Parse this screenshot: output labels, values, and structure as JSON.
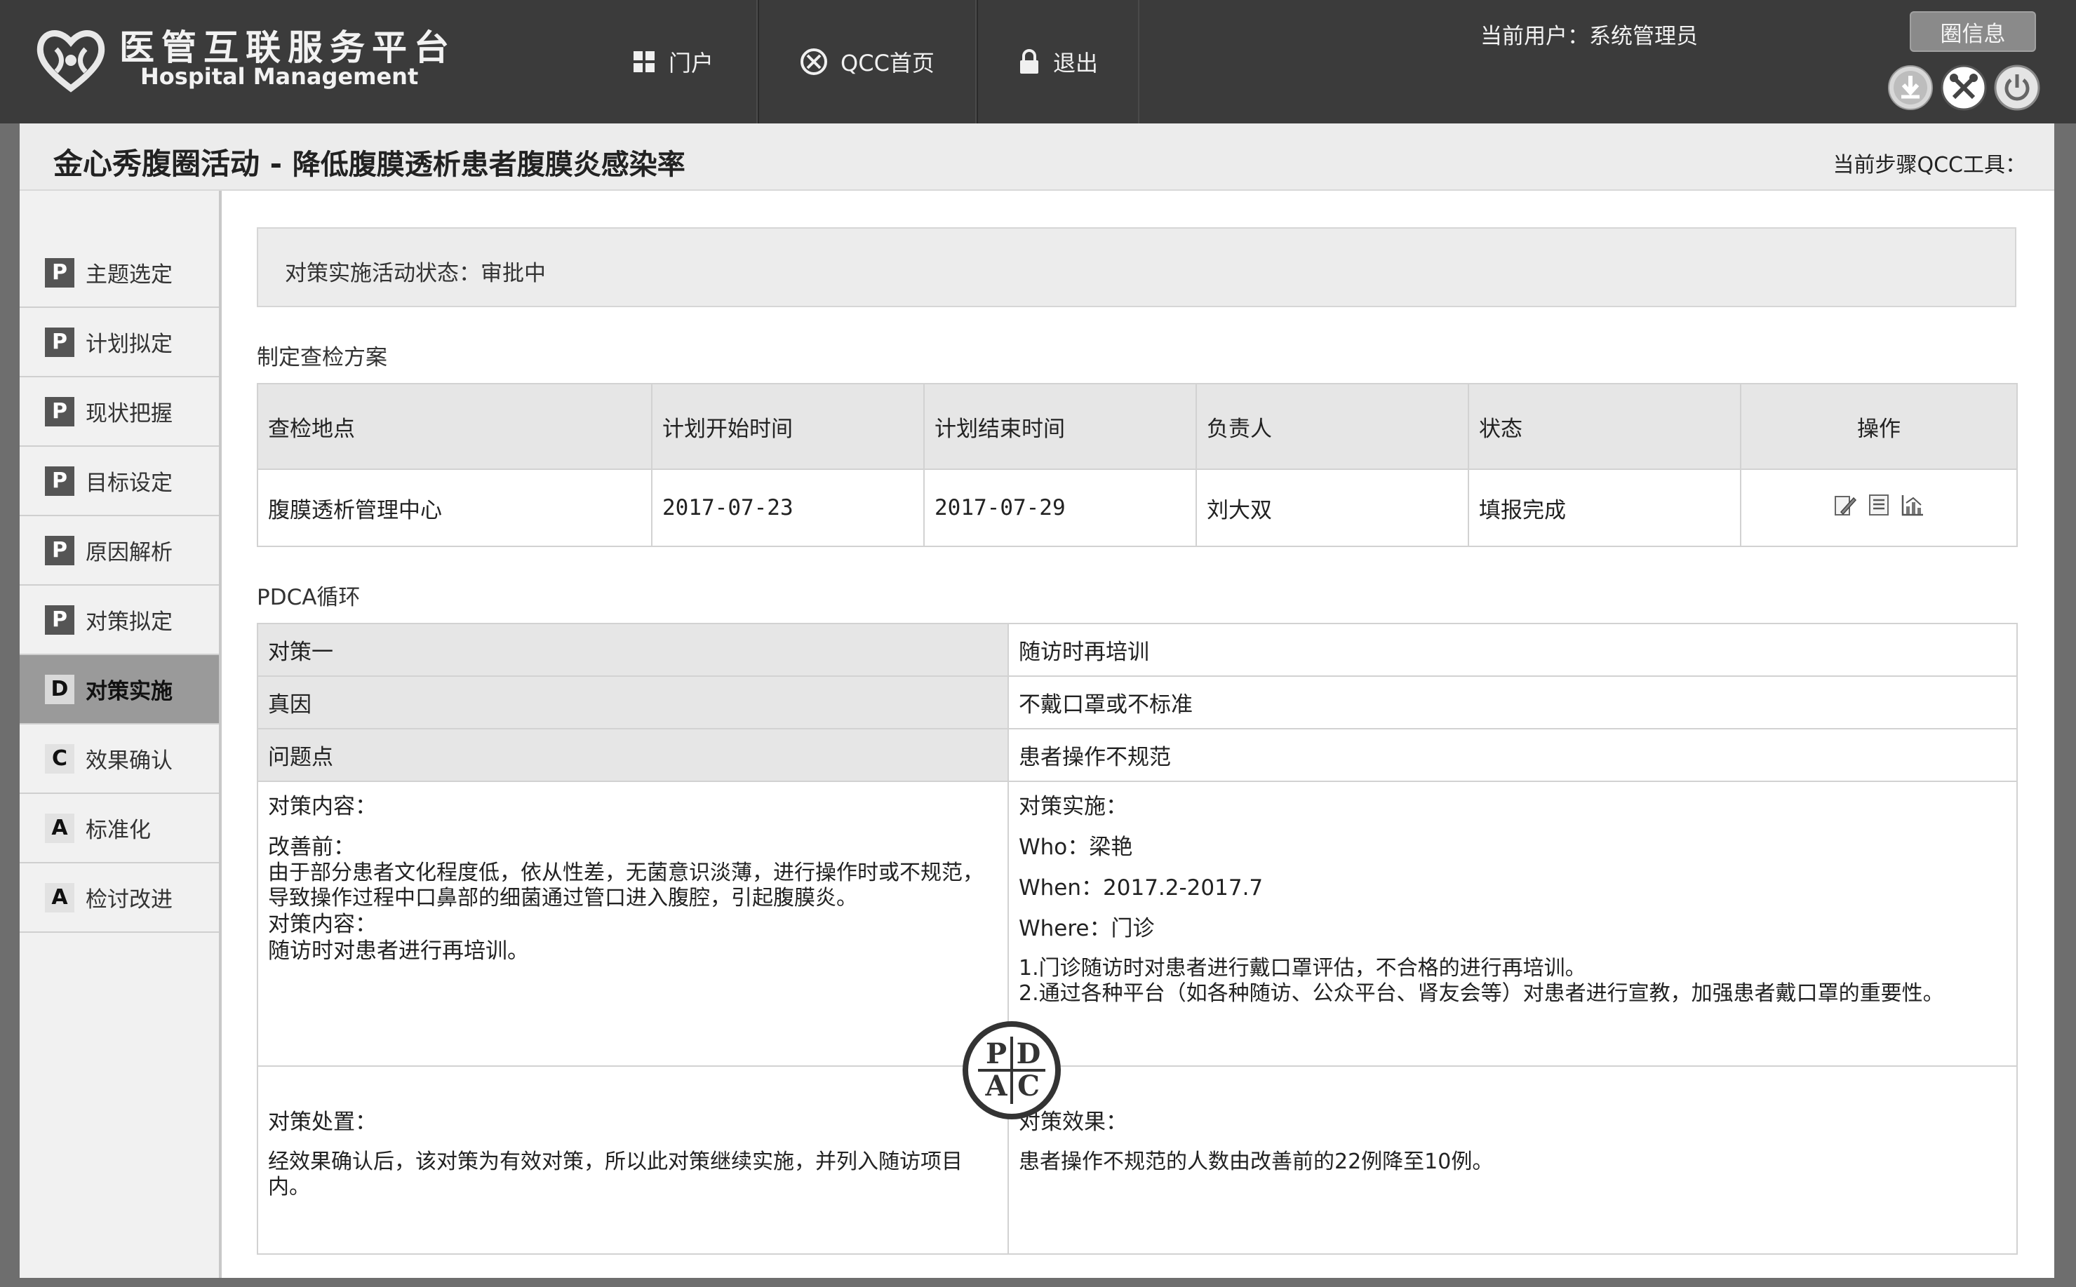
{
  "header": {
    "logo_title": "医管互联服务平台",
    "logo_subtitle": "Hospital Management",
    "nav": [
      {
        "label": "门户",
        "icon": "grid-icon"
      },
      {
        "label": "QCC首页",
        "icon": "qcc-icon"
      },
      {
        "label": "退出",
        "icon": "lock-icon"
      }
    ],
    "current_user": "当前用户：系统管理员",
    "message_button": "圈信息",
    "tool_icons": [
      "download-icon",
      "tools-icon",
      "power-icon"
    ]
  },
  "title_bar": {
    "circle_name": "金心秀腹圈活动",
    "separator": " - ",
    "topic": "降低腹膜透析患者腹膜炎感染率",
    "current_step": "当前步骤QCC工具："
  },
  "sidebar": {
    "items": [
      {
        "phase": "P",
        "label": "主题选定"
      },
      {
        "phase": "P",
        "label": "计划拟定"
      },
      {
        "phase": "P",
        "label": "现状把握"
      },
      {
        "phase": "P",
        "label": "目标设定"
      },
      {
        "phase": "P",
        "label": "原因解析"
      },
      {
        "phase": "P",
        "label": "对策拟定"
      },
      {
        "phase": "D",
        "label": "对策实施",
        "active": true
      },
      {
        "phase": "C",
        "label": "效果确认"
      },
      {
        "phase": "A",
        "label": "标准化"
      },
      {
        "phase": "A",
        "label": "检讨改进"
      }
    ]
  },
  "status": {
    "text": "对策实施活动状态：审批中"
  },
  "inspection": {
    "section_title": "制定查检方案",
    "columns": [
      "查检地点",
      "计划开始时间",
      "计划结束时间",
      "负责人",
      "状态",
      "操作"
    ],
    "rows": [
      {
        "location": "腹膜透析管理中心",
        "start": "2017-07-23",
        "end": "2017-07-29",
        "owner": "刘大双",
        "state": "填报完成",
        "actions": [
          "edit-icon",
          "list-icon",
          "chart-icon"
        ]
      }
    ]
  },
  "pdca": {
    "section_title": "PDCA循环",
    "countermeasure_label": "对策一",
    "countermeasure_value": "随访时再培训",
    "cause_label": "真因",
    "cause_value": "不戴口罩或不标准",
    "problem_label": "问题点",
    "problem_value": "患者操作不规范",
    "content": {
      "heading": "对策内容：",
      "before_label": "改善前：",
      "before_text": "由于部分患者文化程度低，依从性差，无菌意识淡薄，进行操作时或不规范，导致操作过程中口鼻部的细菌通过管口进入腹腔，引起腹膜炎。",
      "measure_label": "对策内容：",
      "measure_text": "随访时对患者进行再培训。"
    },
    "implementation": {
      "heading": "对策实施：",
      "who": "Who：梁艳",
      "when": "When：2017.2-2017.7",
      "where": "Where：门诊",
      "step1": "1.门诊随访时对患者进行戴口罩评估，不合格的进行再培训。",
      "step2": "2.通过各种平台（如各种随访、公众平台、肾友会等）对患者进行宣教，加强患者戴口罩的重要性。"
    },
    "disposal": {
      "heading": "对策处置：",
      "text": "经效果确认后，该对策为有效对策，所以此对策继续实施，并列入随访项目内。"
    },
    "effect": {
      "heading": "对策效果：",
      "text": "患者操作不规范的人数由改善前的22例降至10例。"
    },
    "logo_letters": [
      "P",
      "D",
      "A",
      "C"
    ]
  }
}
